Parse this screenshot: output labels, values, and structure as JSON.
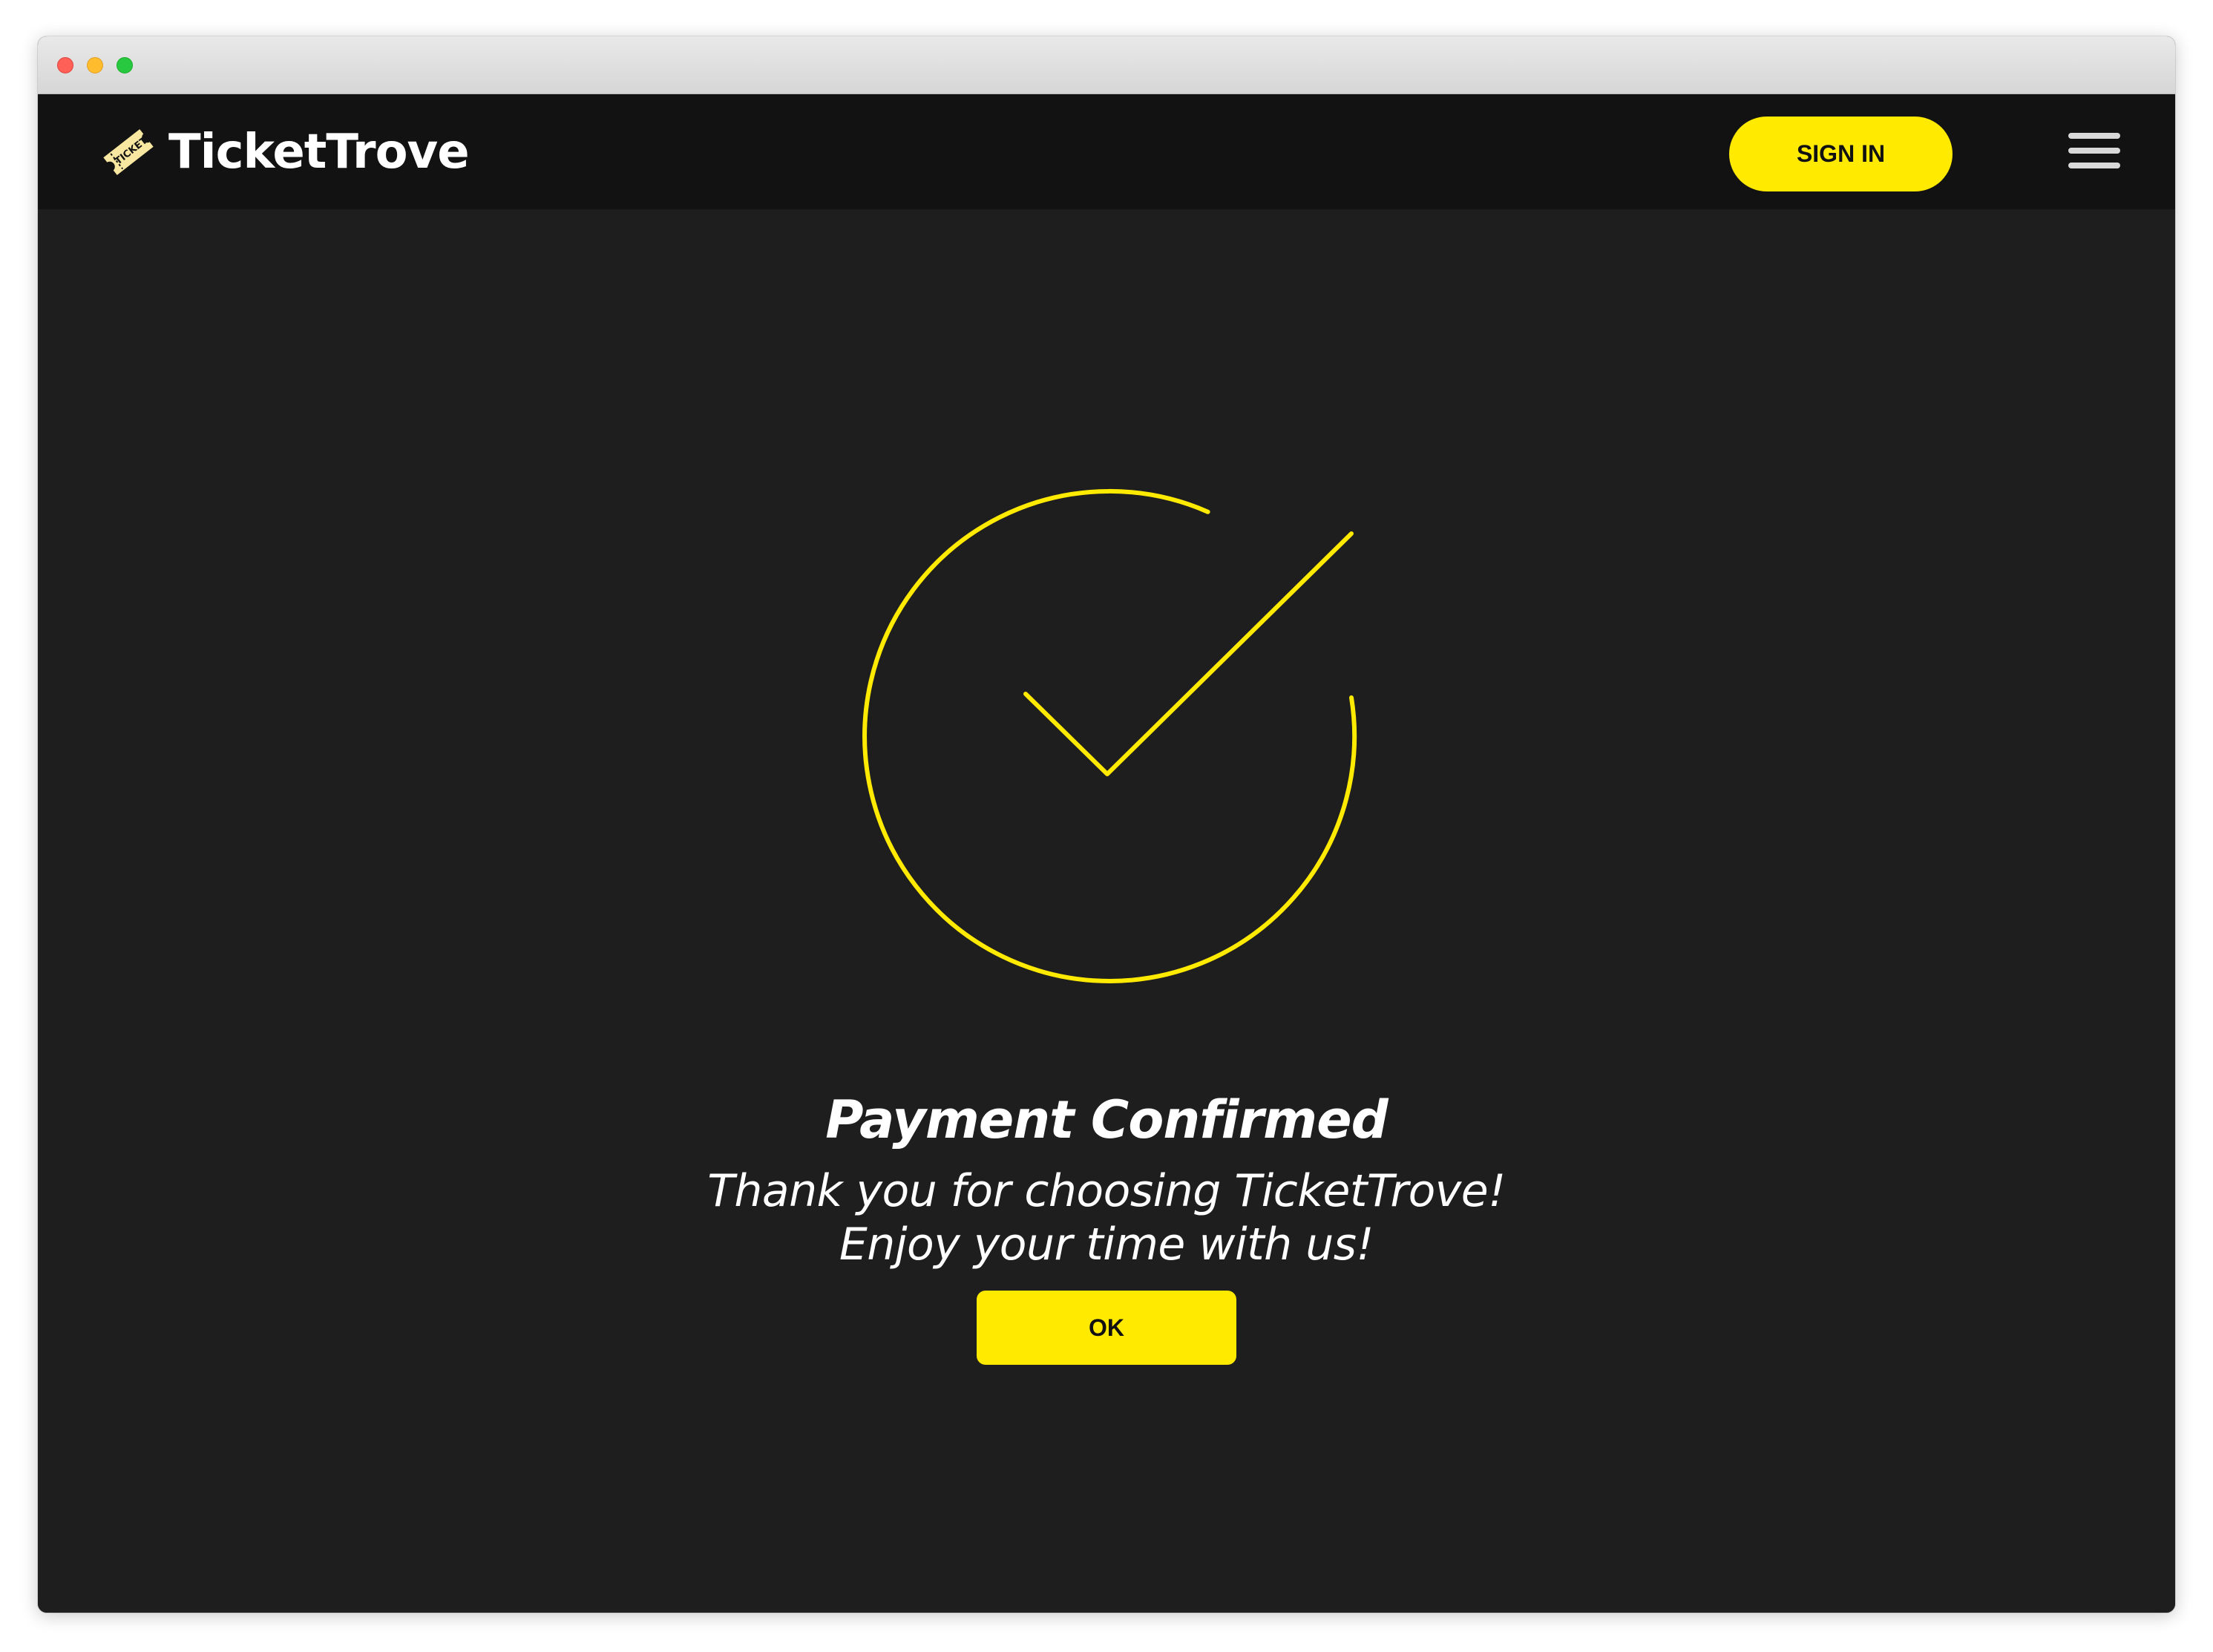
{
  "brand": {
    "name": "TicketTrove",
    "logo_badge_text": "TICKET",
    "accent_color": "#ffea00"
  },
  "window_controls": [
    "close",
    "minimize",
    "zoom"
  ],
  "header": {
    "sign_in_label": "SIGN IN",
    "menu_icon": "hamburger-menu-icon"
  },
  "confirmation": {
    "icon": "checkmark-circle-icon",
    "title": "Payment Confirmed",
    "message_line1": "Thank you for choosing TicketTrove!",
    "message_line2": "Enjoy your time with us!",
    "ok_label": "OK"
  }
}
